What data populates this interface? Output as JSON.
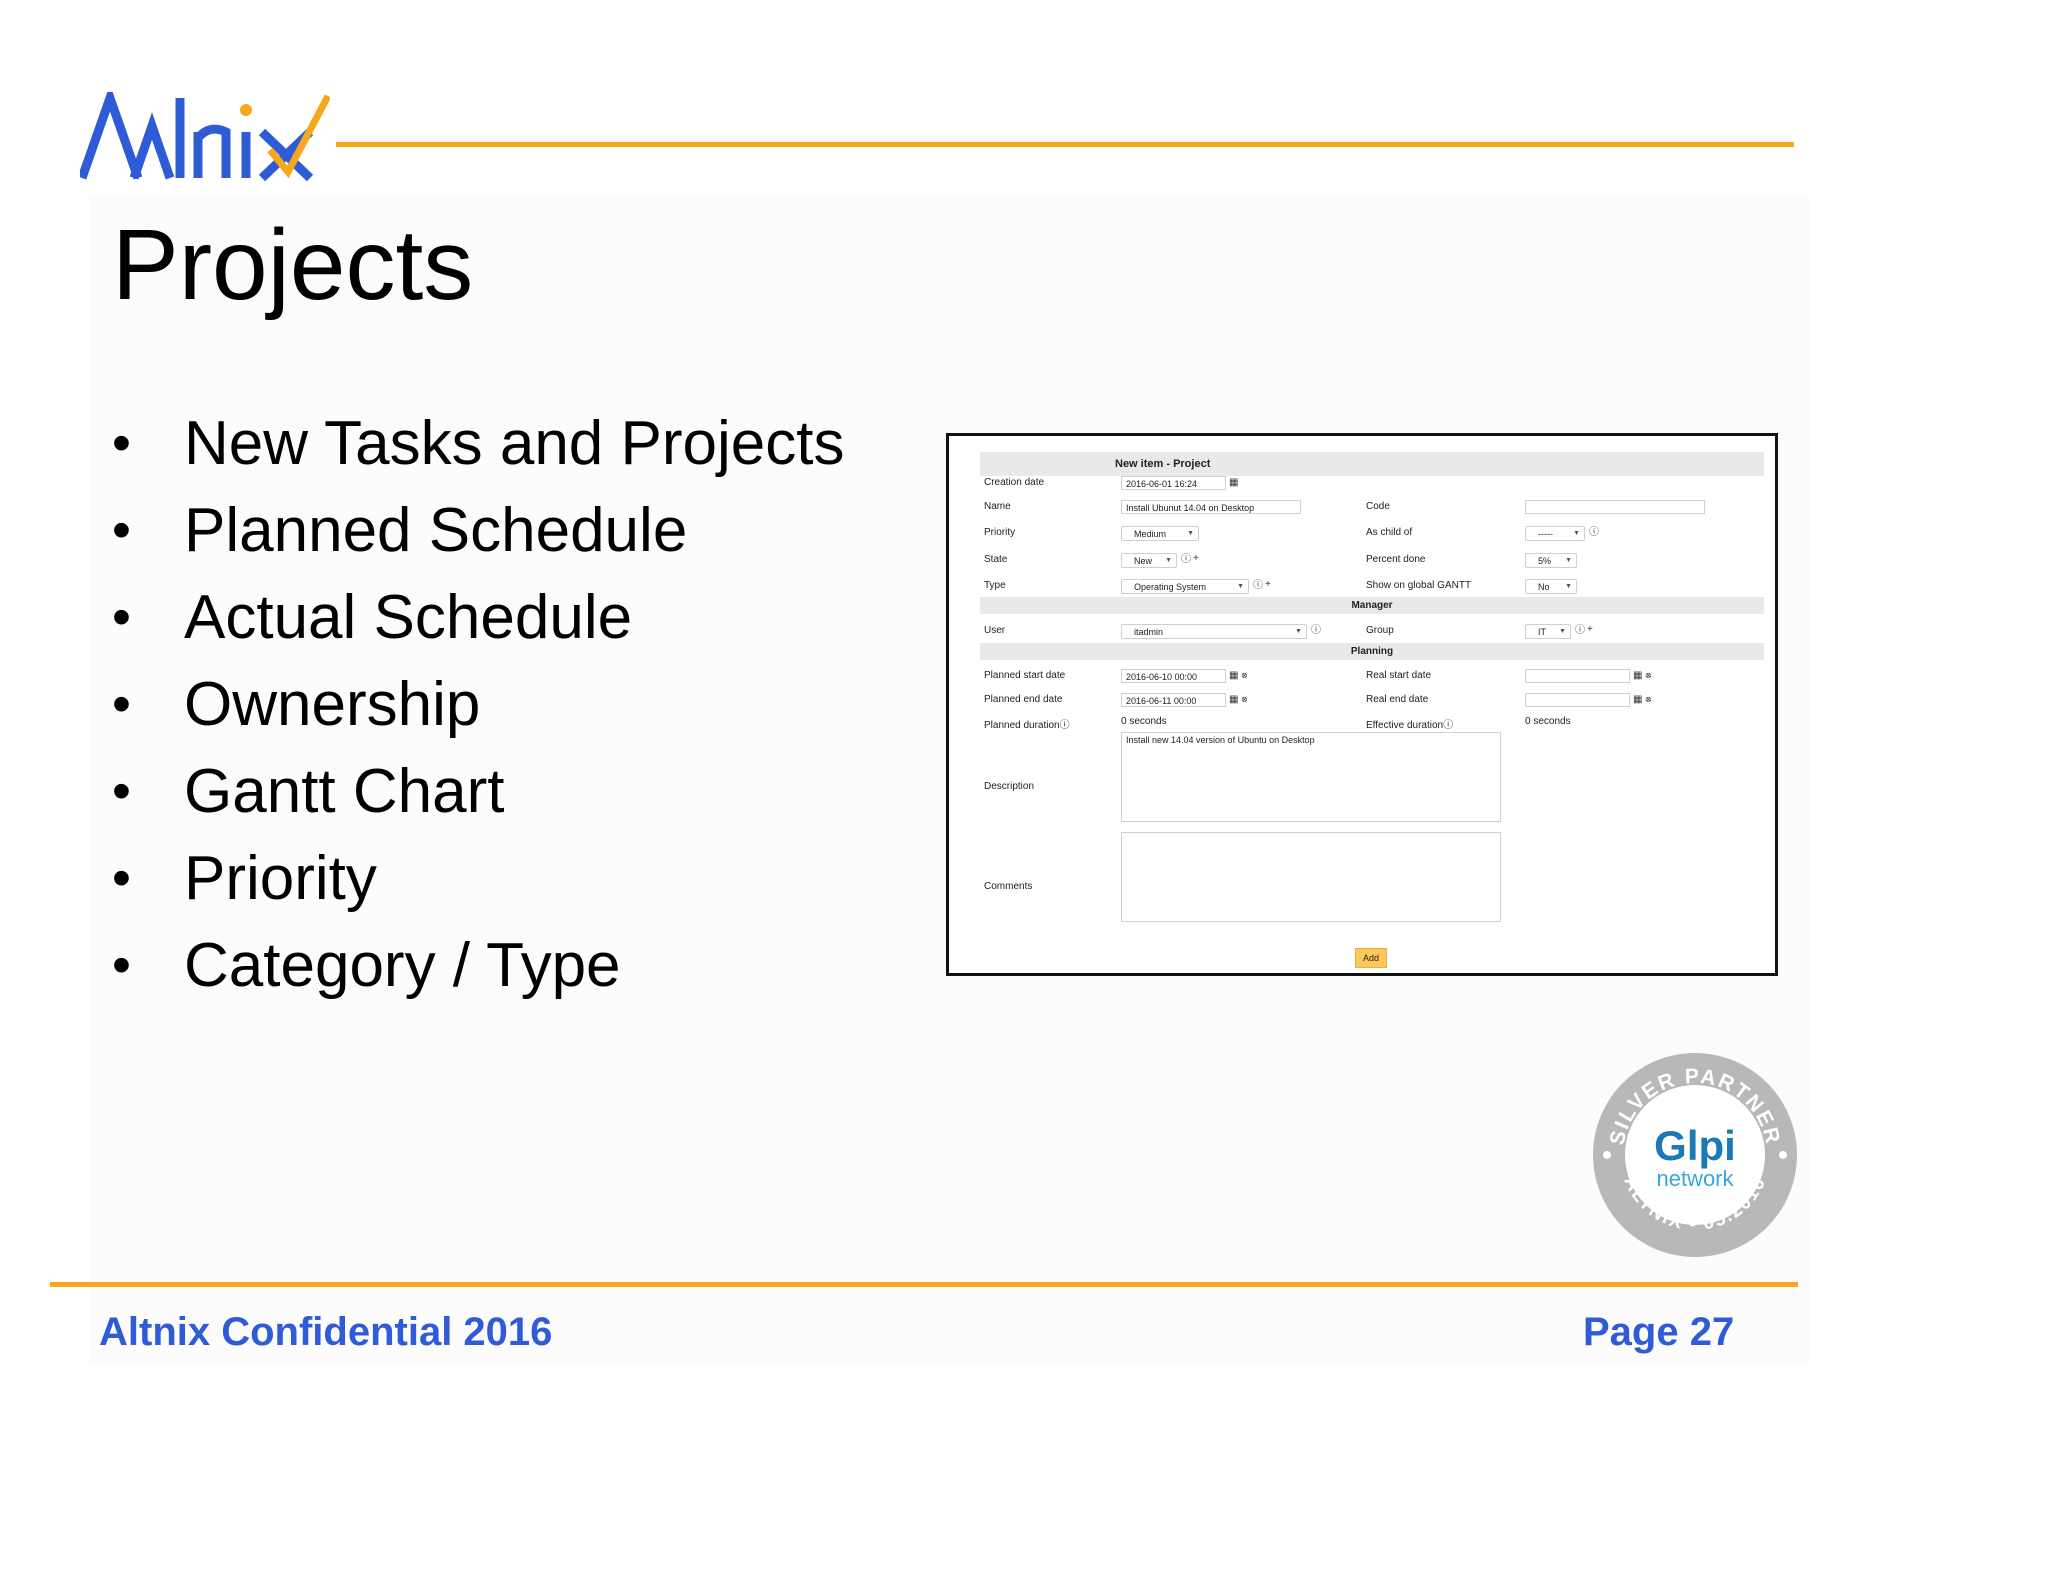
{
  "header": {
    "logo_text": "Altnix",
    "title": "Projects"
  },
  "bullets": [
    "New Tasks and Projects",
    "Planned Schedule",
    "Actual Schedule",
    "Ownership",
    "Gantt Chart",
    "Priority",
    "Category / Type"
  ],
  "form": {
    "header": "New item - Project",
    "creation_date_label": "Creation date",
    "creation_date": "2016-06-01 16:24",
    "name_label": "Name",
    "name": "Install Ubunut 14.04 on Desktop",
    "code_label": "Code",
    "code": "",
    "priority_label": "Priority",
    "priority": "Medium",
    "as_child_label": "As child of",
    "as_child": "-----",
    "state_label": "State",
    "state": "New",
    "percent_label": "Percent done",
    "percent": "5%",
    "type_label": "Type",
    "type": "Operating System",
    "gantt_label": "Show on global GANTT",
    "gantt": "No",
    "manager_section": "Manager",
    "user_label": "User",
    "user": "itadmin",
    "group_label": "Group",
    "group": "IT",
    "planning_section": "Planning",
    "planned_start_label": "Planned start date",
    "planned_start": "2016-06-10 00:00",
    "real_start_label": "Real start date",
    "planned_end_label": "Planned end date",
    "planned_end": "2016-06-11 00:00",
    "real_end_label": "Real end date",
    "planned_duration_label": "Planned duration",
    "planned_duration": "0 seconds",
    "effective_duration_label": "Effective duration",
    "effective_duration": "0 seconds",
    "description_label": "Description",
    "description": "Install new 14.04 version of Ubuntu on Desktop",
    "comments_label": "Comments",
    "comments": "",
    "add_button": "Add"
  },
  "badge": {
    "top_text": "SILVER PARTNER",
    "brand": "Glpi",
    "sub": "network",
    "bottom_text": "ALTNIX - 05.2016"
  },
  "footer": {
    "left": "Altnix Confidential 2016",
    "right": "Page 27"
  },
  "colors": {
    "accent_orange": "#f5a81c",
    "brand_blue": "#2f5bd6",
    "badge_gray": "#b8b8b8",
    "button_yellow": "#fec95c"
  }
}
